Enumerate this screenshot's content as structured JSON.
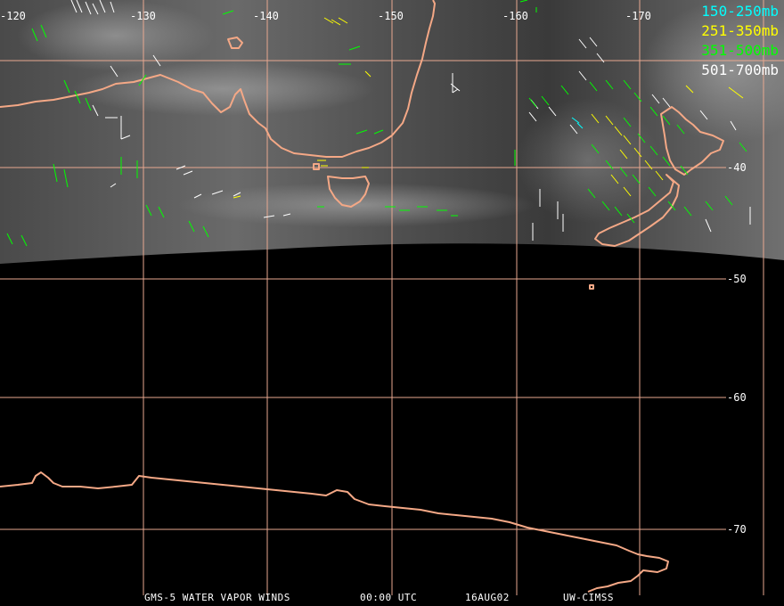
{
  "legend": [
    {
      "label": "150-250mb",
      "color": "#00ffff"
    },
    {
      "label": "251-350mb",
      "color": "#ffff00"
    },
    {
      "label": "351-500mb",
      "color": "#00ff00"
    },
    {
      "label": "501-700mb",
      "color": "#ffffff"
    }
  ],
  "longitude_labels": [
    "-120",
    "-130",
    "-140",
    "-150",
    "-160",
    "-170"
  ],
  "latitude_labels": [
    "-40",
    "-50",
    "-60",
    "-70"
  ],
  "footer": {
    "product": "GMS-5 WATER VAPOR WINDS",
    "time": "00:00 UTC",
    "date": "16AUG02",
    "source": "UW-CIMSS"
  },
  "colors": {
    "background": "#000000",
    "coastline": "#f4a886",
    "grid": "#e8a890"
  }
}
